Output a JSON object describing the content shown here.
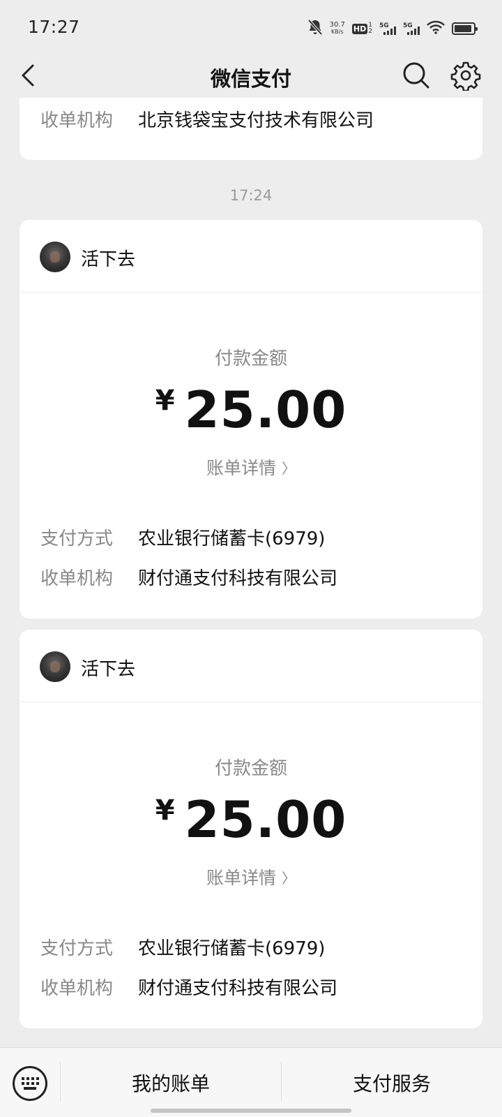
{
  "status_bar": {
    "time": "17:27",
    "net_speed": "30.7",
    "net_unit": "KB/s",
    "hd_label": "HD",
    "hd_sub_top": "1",
    "hd_sub_bottom": "2",
    "signal1_label": "5G",
    "signal2_label": "5G",
    "icons": [
      "bell-off-icon",
      "hd-icon",
      "signal-icon",
      "signal-icon",
      "wifi-icon",
      "battery-icon"
    ]
  },
  "nav": {
    "title": "微信支付",
    "icons": [
      "back-arrow-icon",
      "search-icon",
      "gear-icon"
    ]
  },
  "partial_card": {
    "row_label": "收单机构",
    "row_value": "北京钱袋宝支付技术有限公司"
  },
  "time_divider": "17:24",
  "payments": [
    {
      "merchant": "活下去",
      "amount_label": "付款金额",
      "currency": "¥",
      "amount": "25.00",
      "detail_link": "账单详情",
      "method_label": "支付方式",
      "method_value": "农业银行储蓄卡(6979)",
      "acquirer_label": "收单机构",
      "acquirer_value": "财付通支付科技有限公司"
    },
    {
      "merchant": "活下去",
      "amount_label": "付款金额",
      "currency": "¥",
      "amount": "25.00",
      "detail_link": "账单详情",
      "method_label": "支付方式",
      "method_value": "农业银行储蓄卡(6979)",
      "acquirer_label": "收单机构",
      "acquirer_value": "财付通支付科技有限公司"
    }
  ],
  "bottom_bar": {
    "keyboard_icon": "keyboard-icon",
    "tabs": [
      {
        "label": "我的账单"
      },
      {
        "label": "支付服务"
      }
    ]
  },
  "colors": {
    "background": "#ededed",
    "card": "#ffffff",
    "text_primary": "#111111",
    "text_secondary": "#888888"
  }
}
